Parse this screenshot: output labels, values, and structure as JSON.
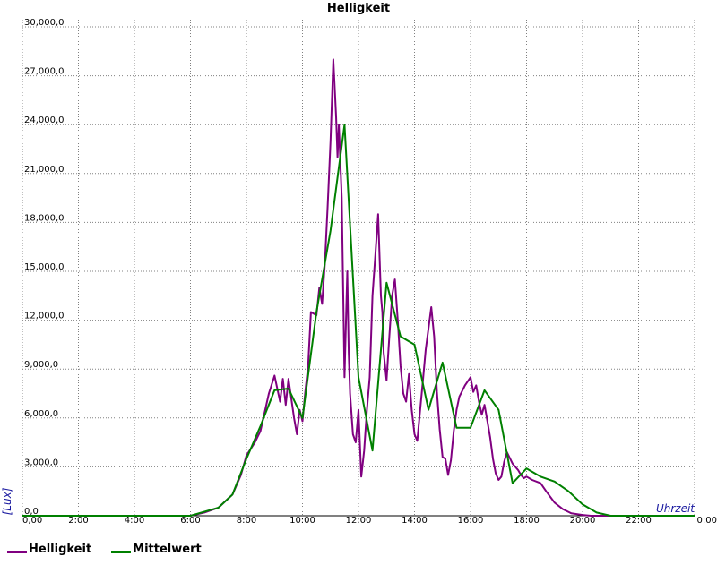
{
  "chart_data": {
    "type": "line",
    "title": "Helligkeit",
    "xlabel": "Uhrzeit",
    "ylabel": "[Lux]",
    "xlim": [
      0,
      24
    ],
    "ylim": [
      0,
      30000
    ],
    "grid": true,
    "legend_position": "bottom-left",
    "x_tick_labels": [
      "0,00",
      "2:00",
      "4:00",
      "6:00",
      "8:00",
      "10:00",
      "12:00",
      "14:00",
      "16:00",
      "18:00",
      "20:00",
      "22:00",
      "0:00"
    ],
    "y_tick_labels": [
      "0,0",
      "3,000,0",
      "6,000,0",
      "9,000,0",
      "12,000,0",
      "15,000,0",
      "18,000,0",
      "21,000,0",
      "24,000,0",
      "27,000,0",
      "30,000,0"
    ],
    "series": [
      {
        "name": "Helligkeit",
        "color": "#800080",
        "x": [
          0,
          6.0,
          6.5,
          7.0,
          7.5,
          7.8,
          8.0,
          8.3,
          8.5,
          8.8,
          9.0,
          9.2,
          9.3,
          9.4,
          9.5,
          9.6,
          9.7,
          9.8,
          9.9,
          10.0,
          10.1,
          10.2,
          10.3,
          10.5,
          10.6,
          10.7,
          10.8,
          10.9,
          11.0,
          11.1,
          11.2,
          11.25,
          11.3,
          11.4,
          11.5,
          11.6,
          11.65,
          11.7,
          11.8,
          11.9,
          12.0,
          12.1,
          12.2,
          12.3,
          12.4,
          12.5,
          12.6,
          12.7,
          12.8,
          12.85,
          12.9,
          13.0,
          13.1,
          13.2,
          13.3,
          13.4,
          13.5,
          13.6,
          13.7,
          13.8,
          13.9,
          14.0,
          14.1,
          14.2,
          14.3,
          14.4,
          14.5,
          14.6,
          14.7,
          14.8,
          14.9,
          15.0,
          15.1,
          15.2,
          15.3,
          15.4,
          15.5,
          15.6,
          15.8,
          16.0,
          16.1,
          16.2,
          16.3,
          16.4,
          16.5,
          16.6,
          16.7,
          16.8,
          16.9,
          17.0,
          17.1,
          17.2,
          17.3,
          17.5,
          17.7,
          17.8,
          17.9,
          18.0,
          18.2,
          18.5,
          18.7,
          19.0,
          19.3,
          19.6,
          20.0,
          20.3,
          20.6,
          21.0,
          22.0,
          23.0,
          24.0
        ],
        "values": [
          0,
          0,
          200,
          500,
          1300,
          2500,
          3700,
          4500,
          5200,
          7500,
          8600,
          7000,
          8400,
          6800,
          8400,
          7200,
          6000,
          5000,
          6500,
          5800,
          7600,
          9200,
          12500,
          12300,
          14000,
          13000,
          15500,
          19000,
          23000,
          28000,
          24500,
          22000,
          24000,
          19500,
          8500,
          15000,
          10000,
          7500,
          5000,
          4500,
          6500,
          2400,
          4000,
          6500,
          8500,
          13500,
          16000,
          18500,
          13500,
          12500,
          10000,
          8300,
          11000,
          13500,
          14500,
          12000,
          9200,
          7500,
          7000,
          8700,
          6500,
          5000,
          4600,
          6500,
          8300,
          10200,
          11500,
          12800,
          11000,
          7600,
          5300,
          3600,
          3500,
          2500,
          3400,
          5200,
          6500,
          7300,
          8000,
          8500,
          7600,
          8000,
          7000,
          6200,
          6800,
          5800,
          4800,
          3500,
          2600,
          2200,
          2400,
          3300,
          3900,
          3200,
          2800,
          2500,
          2300,
          2400,
          2200,
          2000,
          1500,
          800,
          400,
          150,
          50,
          0,
          0,
          0,
          0,
          0,
          0
        ]
      },
      {
        "name": "Mittelwert",
        "color": "#008000",
        "x": [
          0,
          6.0,
          7.0,
          7.5,
          8.0,
          8.5,
          9.0,
          9.5,
          10.0,
          10.5,
          11.0,
          11.5,
          12.0,
          12.5,
          13.0,
          13.5,
          14.0,
          14.5,
          15.0,
          15.5,
          16.0,
          16.5,
          17.0,
          17.5,
          18.0,
          18.5,
          19.0,
          19.5,
          20.0,
          20.5,
          21.0,
          22.0,
          23.0,
          24.0
        ],
        "values": [
          0,
          0,
          500,
          1300,
          3500,
          5500,
          7700,
          7800,
          6000,
          12500,
          17500,
          24000,
          8500,
          4000,
          14300,
          11000,
          10500,
          6500,
          9400,
          5400,
          5400,
          7700,
          6500,
          2000,
          2900,
          2400,
          2100,
          1500,
          700,
          200,
          0,
          0,
          0,
          0
        ]
      }
    ]
  }
}
